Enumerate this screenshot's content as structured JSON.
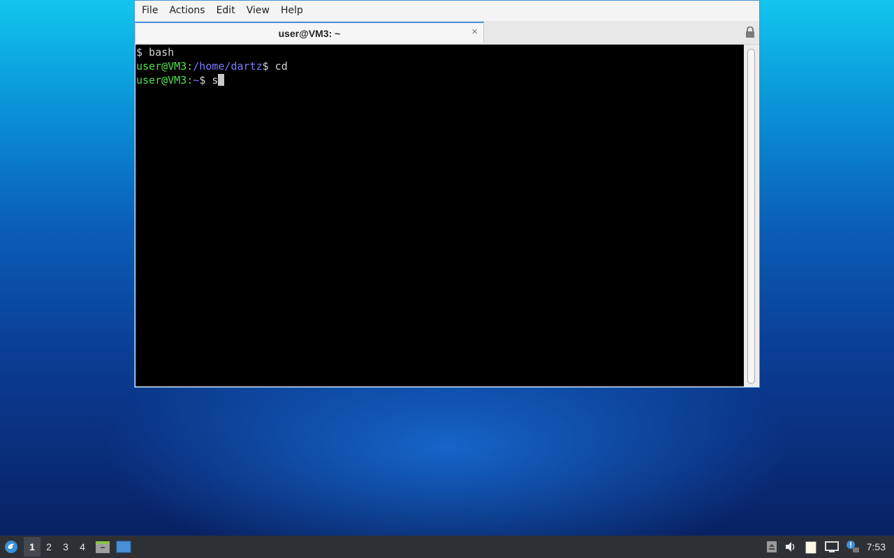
{
  "menu": [
    "File",
    "Actions",
    "Edit",
    "View",
    "Help"
  ],
  "tab": {
    "title": "user@VM3: ~",
    "close": "×"
  },
  "terminal": {
    "line1": "$ bash",
    "line2": {
      "user": "user@VM3:",
      "path": "/home/dartz",
      "rest": "$ cd"
    },
    "line3": {
      "user": "user@VM3:",
      "path": "~",
      "rest": "$ s"
    }
  },
  "taskbar": {
    "workspaces": [
      "1",
      "2",
      "3",
      "4"
    ],
    "active_workspace": "1",
    "clock": "7:53"
  },
  "colors": {
    "accent": "#4a90d9",
    "prompt_green": "#4ee34e",
    "path_blue": "#7b7bff"
  }
}
